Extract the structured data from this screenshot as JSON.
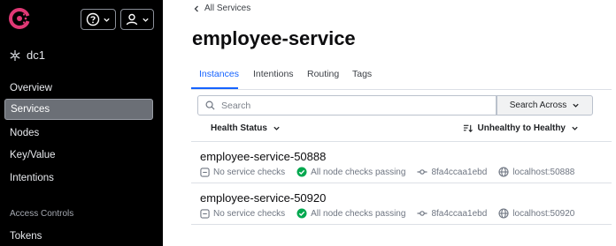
{
  "sidebar": {
    "datacenter": "dc1",
    "nav_items": [
      {
        "label": "Overview"
      },
      {
        "label": "Services"
      },
      {
        "label": "Nodes"
      },
      {
        "label": "Key/Value"
      },
      {
        "label": "Intentions"
      }
    ],
    "section_heading": "Access Controls",
    "section_items": [
      {
        "label": "Tokens"
      }
    ],
    "active_item": "Services"
  },
  "breadcrumb": {
    "label": "All Services"
  },
  "page_title": "employee-service",
  "tabs": [
    {
      "label": "Instances"
    },
    {
      "label": "Intentions"
    },
    {
      "label": "Routing"
    },
    {
      "label": "Tags"
    }
  ],
  "active_tab": "Instances",
  "search": {
    "placeholder": "Search",
    "value": ""
  },
  "search_across": {
    "label": "Search Across"
  },
  "filters": {
    "health_status": "Health Status",
    "sort": "Unhealthy to Healthy"
  },
  "instances": [
    {
      "name": "employee-service-50888",
      "service_checks": "No service checks",
      "node_checks": "All node checks passing",
      "node_id": "8fa4ccaa1ebd",
      "address": "localhost:50888"
    },
    {
      "name": "employee-service-50920",
      "service_checks": "No service checks",
      "node_checks": "All node checks passing",
      "node_id": "8fa4ccaa1ebd",
      "address": "localhost:50920"
    }
  ],
  "colors": {
    "accent": "#1563ff",
    "brand": "#e03875",
    "passing": "#00a84f",
    "sidebar_bg": "#000000"
  }
}
